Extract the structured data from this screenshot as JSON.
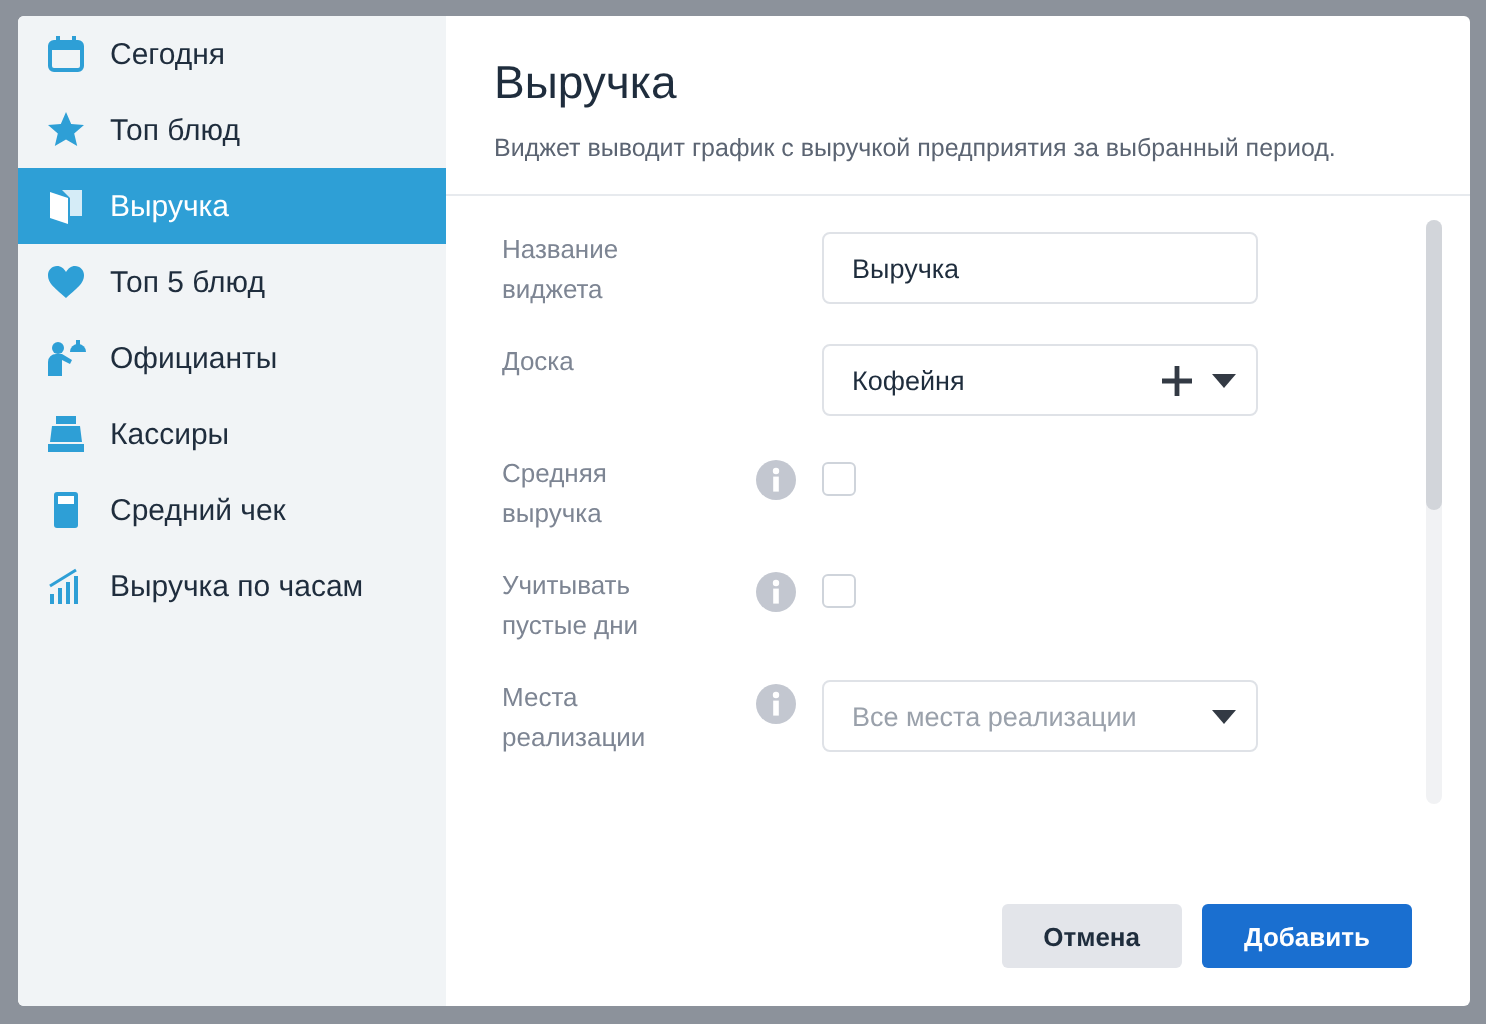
{
  "sidebar": {
    "items": [
      {
        "label": "Сегодня",
        "selected": false
      },
      {
        "label": "Топ блюд",
        "selected": false
      },
      {
        "label": "Выручка",
        "selected": true
      },
      {
        "label": "Топ 5 блюд",
        "selected": false
      },
      {
        "label": "Официанты",
        "selected": false
      },
      {
        "label": "Кассиры",
        "selected": false
      },
      {
        "label": "Средний чек",
        "selected": false
      },
      {
        "label": "Выручка по часам",
        "selected": false
      }
    ]
  },
  "dialog": {
    "title": "Выручка",
    "description": "Виджет выводит график с выручкой предприятия за выбранный период.",
    "fields": [
      {
        "kind": "text",
        "label": "Название виджета",
        "value": "Выручка",
        "info": false
      },
      {
        "kind": "select",
        "label": "Доска",
        "value": "Кофейня",
        "info": false,
        "addable": true
      },
      {
        "kind": "checkbox",
        "label": "Средняя выручка",
        "info": true,
        "checked": false
      },
      {
        "kind": "checkbox",
        "label": "Учитывать пустые дни",
        "info": true,
        "checked": false
      },
      {
        "kind": "select",
        "label": "Места реализации",
        "placeholder": "Все места реализации",
        "info": true,
        "addable": false
      }
    ],
    "buttons": [
      {
        "label": "Отмена",
        "kind": "secondary"
      },
      {
        "label": "Добавить",
        "kind": "primary"
      }
    ]
  }
}
